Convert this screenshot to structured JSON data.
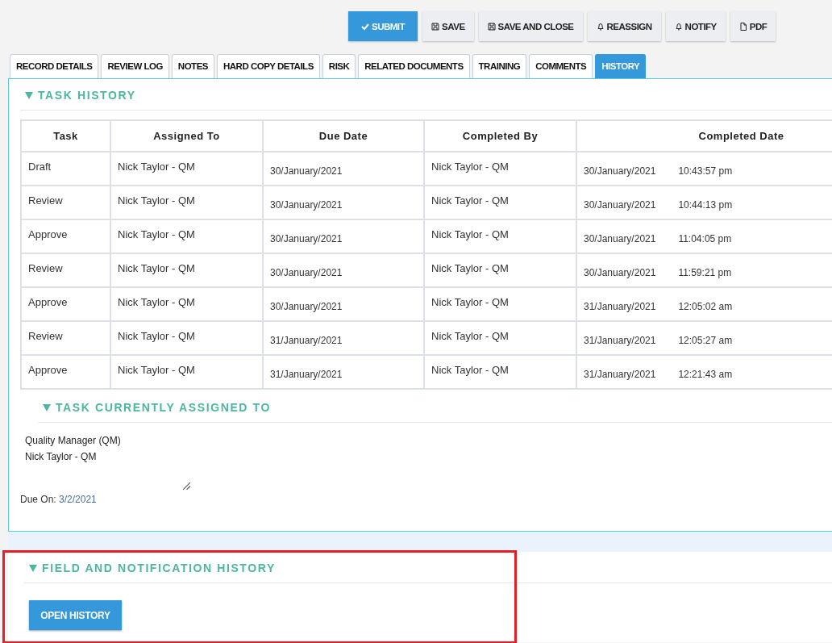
{
  "toolbar": [
    {
      "label": "SUBMIT",
      "kind": "primary"
    },
    {
      "label": "SAVE",
      "kind": "default"
    },
    {
      "label": "SAVE AND CLOSE",
      "kind": "default"
    },
    {
      "label": "REASSIGN",
      "kind": "default"
    },
    {
      "label": "NOTIFY",
      "kind": "default"
    },
    {
      "label": "PDF",
      "kind": "default"
    }
  ],
  "tabs": [
    {
      "label": "RECORD DETAILS",
      "selected": false
    },
    {
      "label": "REVIEW LOG",
      "selected": false
    },
    {
      "label": "NOTES",
      "selected": false
    },
    {
      "label": "HARD COPY DETAILS",
      "selected": false
    },
    {
      "label": "RISK",
      "selected": false
    },
    {
      "label": "RELATED DOCUMENTS",
      "selected": false
    },
    {
      "label": "TRAINING",
      "selected": false
    },
    {
      "label": "COMMENTS",
      "selected": false
    },
    {
      "label": "HISTORY",
      "selected": true
    }
  ],
  "task_history": {
    "title": "TASK HISTORY",
    "columns": [
      "Task",
      "Assigned To",
      "Due Date",
      "Completed By",
      "Completed Date"
    ],
    "rows": [
      {
        "task": "Draft",
        "assigned_to": "Nick Taylor - QM",
        "due_date": "30/January/2021",
        "completed_by": "Nick Taylor - QM",
        "completed_date": "30/January/2021",
        "completed_time": "10:43:57 pm"
      },
      {
        "task": "Review",
        "assigned_to": "Nick Taylor - QM",
        "due_date": "30/January/2021",
        "completed_by": "Nick Taylor - QM",
        "completed_date": "30/January/2021",
        "completed_time": "10:44:13 pm"
      },
      {
        "task": "Approve",
        "assigned_to": "Nick Taylor - QM",
        "due_date": "30/January/2021",
        "completed_by": "Nick Taylor - QM",
        "completed_date": "30/January/2021",
        "completed_time": "11:04:05 pm"
      },
      {
        "task": "Review",
        "assigned_to": "Nick Taylor - QM",
        "due_date": "30/January/2021",
        "completed_by": "Nick Taylor - QM",
        "completed_date": "30/January/2021",
        "completed_time": "11:59:21 pm"
      },
      {
        "task": "Approve",
        "assigned_to": "Nick Taylor - QM",
        "due_date": "30/January/2021",
        "completed_by": "Nick Taylor - QM",
        "completed_date": "31/January/2021",
        "completed_time": "12:05:02 am"
      },
      {
        "task": "Review",
        "assigned_to": "Nick Taylor - QM",
        "due_date": "31/January/2021",
        "completed_by": "Nick Taylor - QM",
        "completed_date": "31/January/2021",
        "completed_time": "12:05:27 am"
      },
      {
        "task": "Approve",
        "assigned_to": "Nick Taylor - QM",
        "due_date": "31/January/2021",
        "completed_by": "Nick Taylor - QM",
        "completed_date": "31/January/2021",
        "completed_time": "12:21:43 am"
      }
    ]
  },
  "current_assignment": {
    "title": "TASK CURRENTLY ASSIGNED TO",
    "lines": [
      "Quality Manager (QM)",
      "Nick Taylor - QM"
    ],
    "due_label": "Due On:",
    "due_value": "3/2/2021"
  },
  "field_history": {
    "title": "FIELD AND NOTIFICATION HISTORY",
    "button": "OPEN HISTORY"
  }
}
